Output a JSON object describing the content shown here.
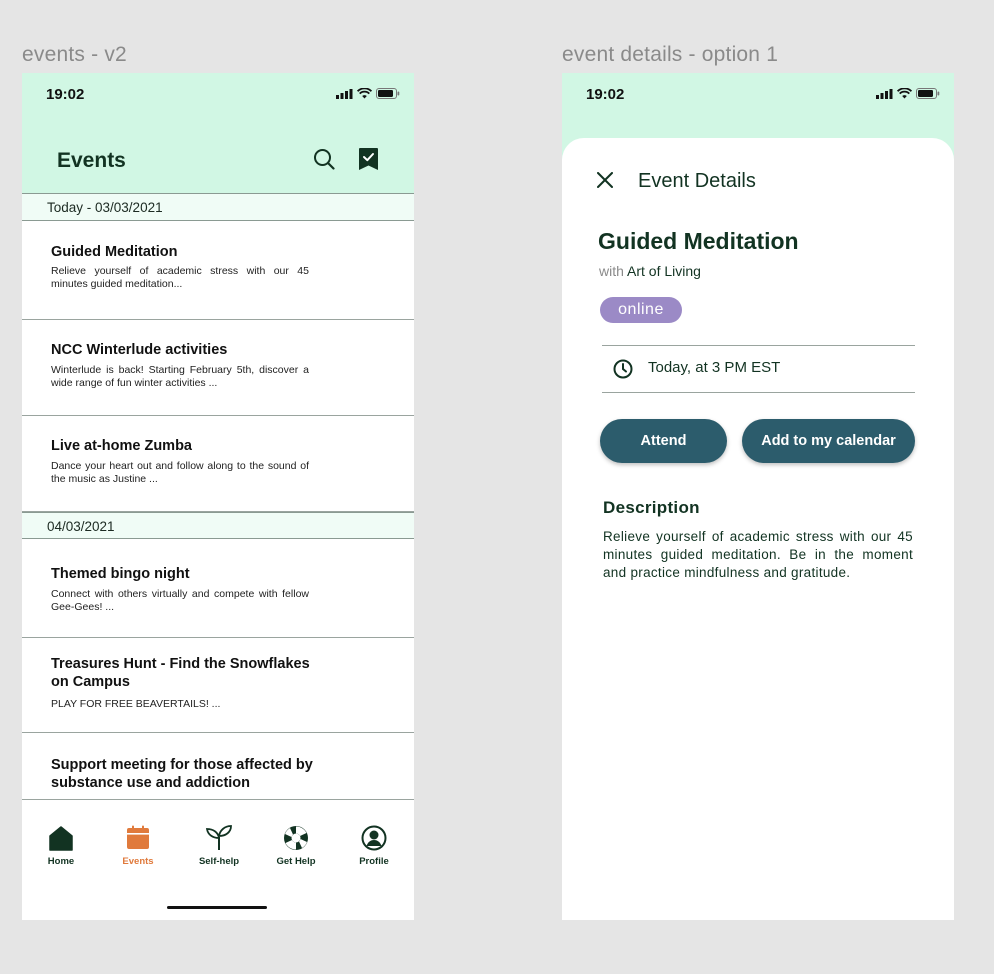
{
  "frames": {
    "left_label": "events - v2",
    "right_label": "event details - option 1"
  },
  "status": {
    "time": "19:02"
  },
  "events_screen": {
    "title": "Events",
    "sections": [
      {
        "date": "Today - 03/03/2021",
        "events": [
          {
            "title": "Guided Meditation",
            "description": "Relieve yourself of academic stress with our 45 minutes guided meditation..."
          },
          {
            "title": "NCC Winterlude activities",
            "description": "Winterlude is back! Starting February 5th, discover a wide range of fun winter activities ..."
          },
          {
            "title": "Live at-home Zumba",
            "description": "Dance your heart out and follow along to the sound of the music as Justine ..."
          }
        ]
      },
      {
        "date": "04/03/2021",
        "events": [
          {
            "title": "Themed bingo night",
            "description": "Connect with others virtually and compete with fellow Gee-Gees! ..."
          },
          {
            "title": "Treasures Hunt - Find the Snowflakes on Campus",
            "description": "PLAY FOR FREE BEAVERTAILS! ..."
          },
          {
            "title": "Support meeting for those affected by substance use and addiction",
            "description": ""
          }
        ]
      }
    ],
    "tabs": [
      {
        "label": "Home",
        "icon": "home-icon"
      },
      {
        "label": "Events",
        "icon": "calendar-icon"
      },
      {
        "label": "Self-help",
        "icon": "sprout-icon"
      },
      {
        "label": "Get Help",
        "icon": "lifebuoy-icon"
      },
      {
        "label": "Profile",
        "icon": "profile-icon"
      }
    ],
    "active_tab": "Events"
  },
  "details_screen": {
    "header": "Event Details",
    "event_title": "Guided Meditation",
    "host_prefix": "with",
    "host_name": "Art of Living",
    "badge": "online",
    "datetime": "Today, at 3 PM EST",
    "attend_label": "Attend",
    "calendar_label": "Add to my calendar",
    "description_heading": "Description",
    "description": "Relieve yourself of academic stress with our 45 minutes guided meditation. Be in the moment and practice mindfulness and gratitude."
  },
  "colors": {
    "mint": "#d1f7e4",
    "primary_button": "#2c5c6c",
    "badge": "#9b8ac6",
    "active_tab": "#e07a3c",
    "dark_green": "#123322"
  }
}
